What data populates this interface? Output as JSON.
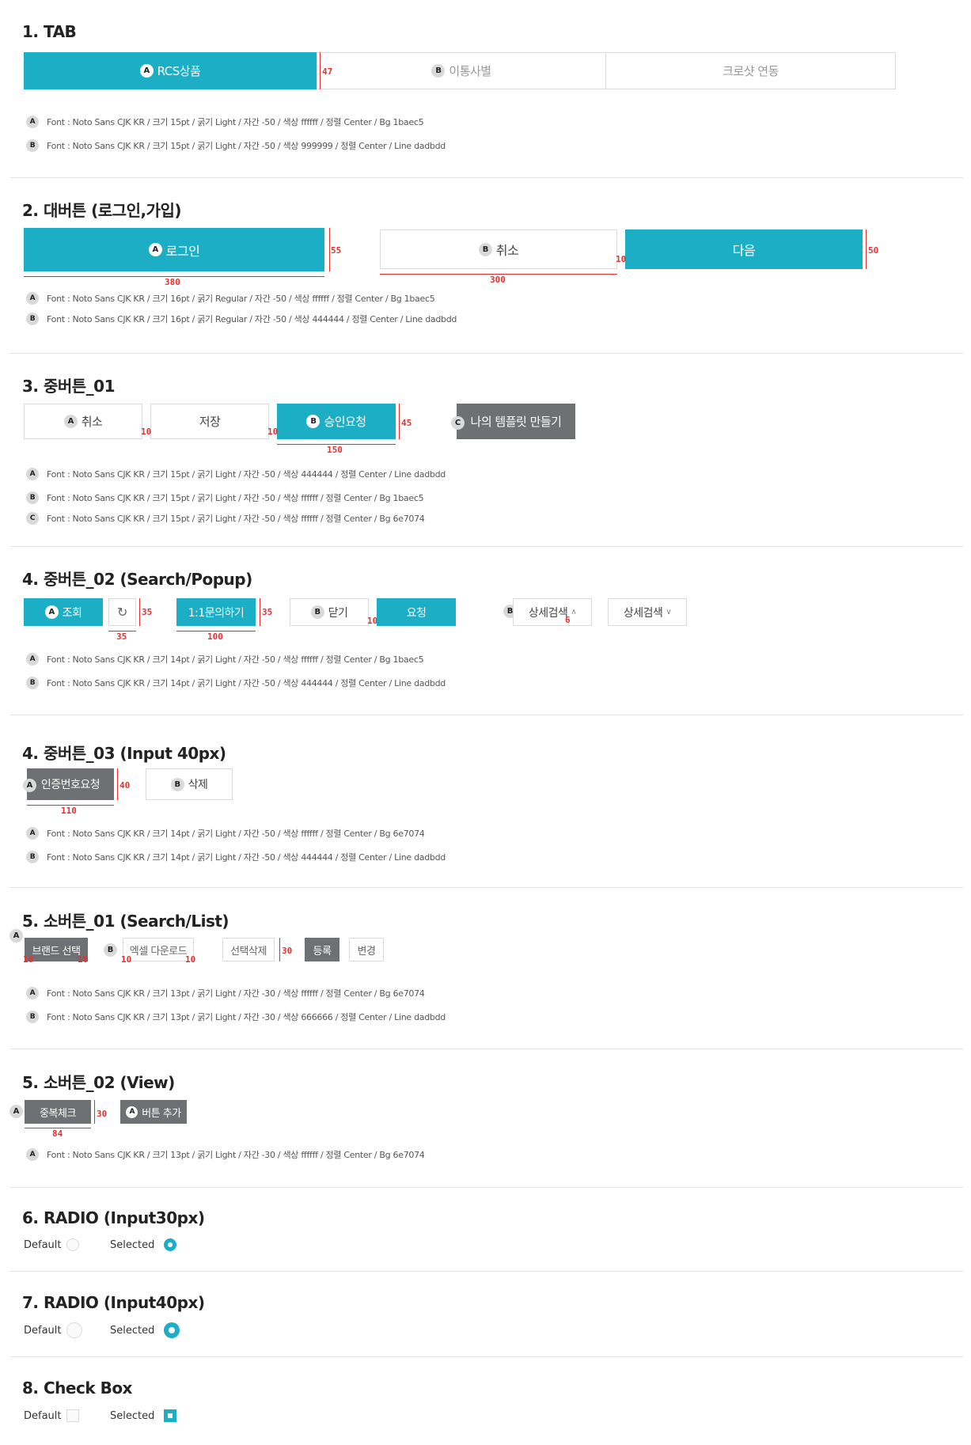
{
  "s1": {
    "title": "1. TAB",
    "tabs": [
      {
        "badge": "A",
        "label": "RCS상품"
      },
      {
        "badge": "B",
        "label": "이통사별"
      },
      {
        "label": "크로샷 연동"
      }
    ],
    "dim_h": "47",
    "notes": [
      {
        "badge": "A",
        "text": "Font : Noto Sans CJK KR / 크기 15pt / 굵기 Light / 자간 -50 / 색상 ffffff / 정렬 Center / Bg 1baec5"
      },
      {
        "badge": "B",
        "text": "Font : Noto Sans CJK KR / 크기 15pt / 굵기 Light / 자간 -50 / 색상 999999 / 정렬 Center / Line dadbdd"
      }
    ]
  },
  "s2": {
    "title": "2. 대버튼 (로그인,가입)",
    "login": {
      "badge": "A",
      "label": "로그인"
    },
    "cancel": {
      "badge": "B",
      "label": "취소"
    },
    "next": {
      "label": "다음"
    },
    "dims": {
      "login_h": "55",
      "login_w": "380",
      "cancel_w": "300",
      "gap": "10",
      "next_h": "50"
    },
    "notes": [
      {
        "badge": "A",
        "text": "Font : Noto Sans CJK KR / 크기 16pt / 굵기 Regular / 자간 -50 / 색상 ffffff / 정렬 Center / Bg 1baec5"
      },
      {
        "badge": "B",
        "text": "Font : Noto Sans CJK KR / 크기 16pt / 굵기 Regular / 자간 -50 / 색상 444444 / 정렬 Center / Line dadbdd"
      }
    ]
  },
  "s3": {
    "title": "3. 중버튼_01",
    "cancel": {
      "badge": "A",
      "label": "취소"
    },
    "save": {
      "label": "저장"
    },
    "approve": {
      "badge": "B",
      "label": "승인요청"
    },
    "template": {
      "badge": "C",
      "label": "나의 템플릿 만들기"
    },
    "dims": {
      "gap1": "10",
      "gap2": "10",
      "h": "45",
      "w": "150"
    },
    "notes": [
      {
        "badge": "A",
        "text": "Font : Noto Sans CJK KR / 크기 15pt / 굵기 Light / 자간 -50 / 색상 444444 / 정렬 Center /  Line dadbdd"
      },
      {
        "badge": "B",
        "text": "Font : Noto Sans CJK KR / 크기 15pt / 굵기 Light / 자간 -50 / 색상 ffffff / 정렬 Center / Bg 1baec5"
      },
      {
        "badge": "C",
        "text": "Font : Noto Sans CJK KR / 크기 15pt / 굵기 Light / 자간 -50 / 색상 ffffff / 정렬 Center / Bg 6e7074"
      }
    ]
  },
  "s4": {
    "title": "4. 중버튼_02 (Search/Popup)",
    "search": {
      "badge": "A",
      "label": "조회"
    },
    "refresh_icon": "refresh-icon",
    "inquiry": {
      "label": "1:1문의하기"
    },
    "close": {
      "badge": "B",
      "label": "닫기"
    },
    "request": {
      "label": "요청"
    },
    "detail_b": {
      "badge": "B",
      "label": "상세검색"
    },
    "detail": {
      "label": "상세검색"
    },
    "dims": {
      "refresh_h": "35",
      "refresh_w": "35",
      "inquiry_h": "35",
      "inquiry_w": "100",
      "gap": "10",
      "chev": "6"
    },
    "notes": [
      {
        "badge": "A",
        "text": "Font : Noto Sans CJK KR / 크기 14pt / 굵기 Light / 자간 -50 / 색상 ffffff / 정렬 Center / Bg 1baec5"
      },
      {
        "badge": "B",
        "text": "Font : Noto Sans CJK KR / 크기 14pt / 굵기 Light / 자간 -50 / 색상 444444 / 정렬 Center / Line dadbdd"
      }
    ]
  },
  "s5": {
    "title": "4. 중버튼_03 (Input 40px)",
    "auth": {
      "badge": "A",
      "label": "인증번호요청"
    },
    "delete": {
      "badge": "B",
      "label": "삭제"
    },
    "dims": {
      "h": "40",
      "w": "110"
    },
    "notes": [
      {
        "badge": "A",
        "text": "Font : Noto Sans CJK KR / 크기 14pt / 굵기 Light / 자간 -50 / 색상 ffffff / 정렬 Center / Bg 6e7074"
      },
      {
        "badge": "B",
        "text": "Font : Noto Sans CJK KR / 크기 14pt / 굵기 Light / 자간 -50 / 색상 444444 / 정렬 Center / Line dadbdd"
      }
    ]
  },
  "s6": {
    "title": "5. 소버튼_01 (Search/List)",
    "brand": {
      "badge": "A",
      "label": "브랜드 선택"
    },
    "excel": {
      "badge": "B",
      "label": "엑셀 다운로드"
    },
    "delete_sel": {
      "label": "선택삭제"
    },
    "register": {
      "label": "등록"
    },
    "change": {
      "label": "변경"
    },
    "dims": {
      "pad": "10",
      "h": "30"
    },
    "notes": [
      {
        "badge": "A",
        "text": "Font : Noto Sans CJK KR / 크기 13pt / 굵기 Light / 자간 -30 / 색상 ffffff / 정렬 Center / Bg 6e7074"
      },
      {
        "badge": "B",
        "text": "Font : Noto Sans CJK KR / 크기 13pt / 굵기 Light / 자간 -30 / 색상 666666 / 정렬 Center / Line dadbdd"
      }
    ]
  },
  "s7": {
    "title": "5. 소버튼_02 (View)",
    "dup": {
      "badge": "A",
      "label": "중복체크"
    },
    "add": {
      "badge": "A",
      "label": "버튼 추가"
    },
    "dims": {
      "h": "30",
      "w": "84"
    },
    "notes": [
      {
        "badge": "A",
        "text": "Font : Noto Sans CJK KR / 크기 13pt / 굵기 Light / 자간 -30 / 색상 ffffff / 정렬 Center / Bg 6e7074"
      }
    ]
  },
  "s8": {
    "title": "6. RADIO (Input30px)",
    "default": "Default",
    "selected": "Selected"
  },
  "s9": {
    "title": "7. RADIO (Input40px)",
    "default": "Default",
    "selected": "Selected"
  },
  "s10": {
    "title": "8. Check Box",
    "default": "Default",
    "selected": "Selected"
  },
  "colors": {
    "teal": "#1baec5",
    "gray": "#6e7074",
    "line": "#dadbdd",
    "dim": "#e63030"
  }
}
